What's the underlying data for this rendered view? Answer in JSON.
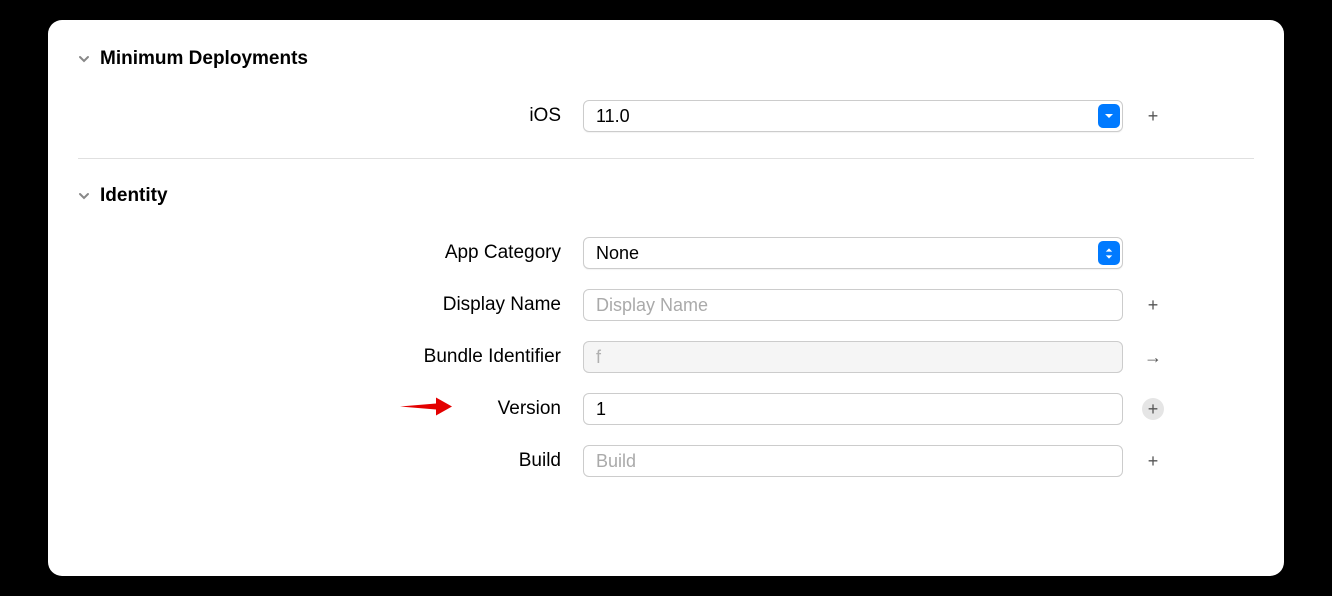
{
  "sections": {
    "deployments": {
      "title": "Minimum Deployments",
      "rows": {
        "ios": {
          "label": "iOS",
          "value": "11.0"
        }
      }
    },
    "identity": {
      "title": "Identity",
      "rows": {
        "appCategory": {
          "label": "App Category",
          "value": "None"
        },
        "displayName": {
          "label": "Display Name",
          "value": "",
          "placeholder": "Display Name"
        },
        "bundleIdentifier": {
          "label": "Bundle Identifier",
          "value": "f                                                        "
        },
        "version": {
          "label": "Version",
          "value": "1"
        },
        "build": {
          "label": "Build",
          "value": "",
          "placeholder": "Build"
        }
      }
    }
  },
  "icons": {
    "plus": "+",
    "arrowRight": "→"
  }
}
